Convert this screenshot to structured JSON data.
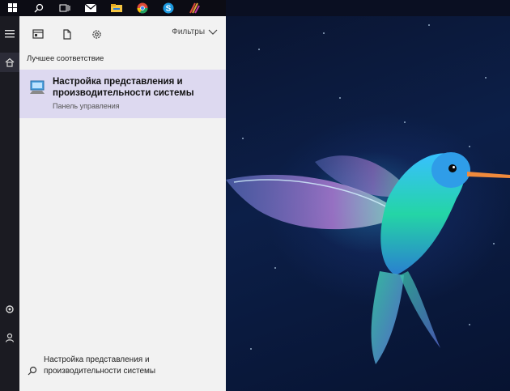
{
  "taskbar": {
    "icons": [
      "windows-icon",
      "search-icon",
      "task-view-icon",
      "mail-icon",
      "file-explorer-icon",
      "chrome-icon",
      "skype-icon",
      "app-icon"
    ]
  },
  "rail": {
    "items": [
      "hamburger-icon",
      "home-icon",
      "settings-icon",
      "user-icon"
    ]
  },
  "panel": {
    "filters_label": "Фильтры",
    "section_title": "Лучшее соответствие",
    "best_match": {
      "title": "Настройка представления и производительности системы",
      "subtitle": "Панель управления"
    },
    "search": {
      "query": "Настройка представления и производительности системы"
    }
  },
  "colors": {
    "highlight": "#ddd9f0",
    "panel_bg": "#f2f2f2",
    "rail_bg": "#1b1b22"
  }
}
